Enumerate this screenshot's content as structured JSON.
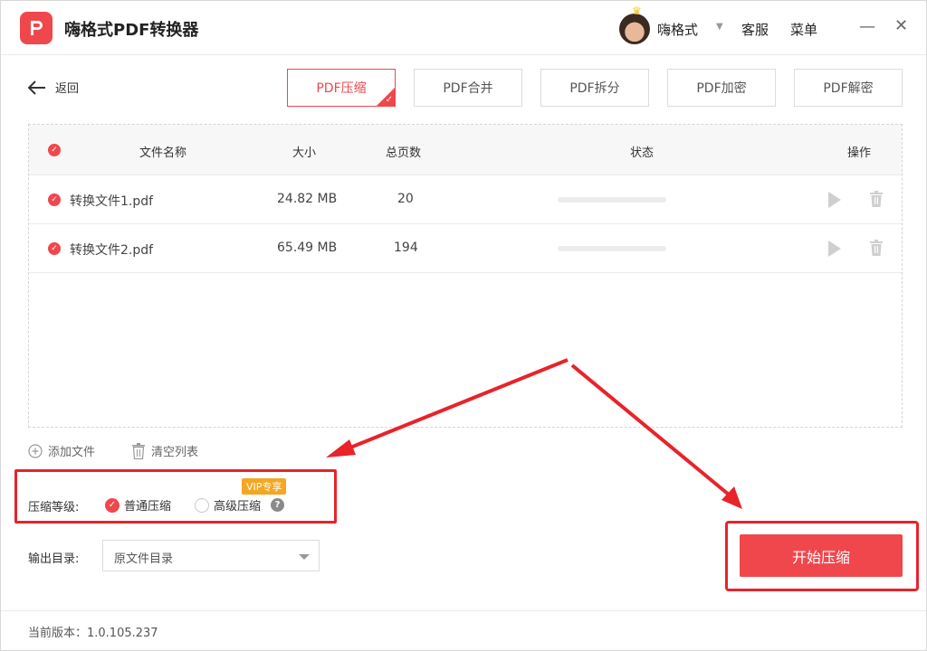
{
  "app": {
    "title": "嗨格式PDF转换器",
    "username": "嗨格式",
    "service_label": "客服",
    "menu_label": "菜单",
    "minimize_glyph": "—",
    "close_glyph": "✕"
  },
  "nav": {
    "back_label": "返回",
    "tabs": [
      {
        "label": "PDF压缩",
        "active": true
      },
      {
        "label": "PDF合并",
        "active": false
      },
      {
        "label": "PDF拆分",
        "active": false
      },
      {
        "label": "PDF加密",
        "active": false
      },
      {
        "label": "PDF解密",
        "active": false
      }
    ]
  },
  "table": {
    "headers": {
      "name": "文件名称",
      "size": "大小",
      "pages": "总页数",
      "status": "状态",
      "action": "操作"
    },
    "rows": [
      {
        "name": "转换文件1.pdf",
        "size": "24.82 MB",
        "pages": "20",
        "progress": 0
      },
      {
        "name": "转换文件2.pdf",
        "size": "65.49 MB",
        "pages": "194",
        "progress": 0
      }
    ]
  },
  "list_actions": {
    "add_file": "添加文件",
    "clear_list": "清空列表"
  },
  "compression": {
    "label": "压缩等级:",
    "normal": "普通压缩",
    "high": "高级压缩",
    "vip_badge": "VIP专享",
    "help_glyph": "?"
  },
  "output": {
    "label": "输出目录:",
    "value": "原文件目录"
  },
  "start_button": "开始压缩",
  "footer": {
    "version": "当前版本：1.0.105.237"
  },
  "colors": {
    "accent": "#f0474c",
    "annotation": "#e8232a",
    "vip": "#f5a623"
  }
}
